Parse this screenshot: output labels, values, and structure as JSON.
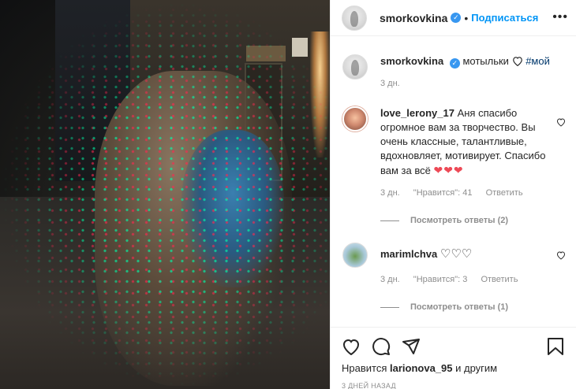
{
  "header": {
    "username": "smorkovkina",
    "separator": "•",
    "follow_label": "Подписаться",
    "more_label": "•••"
  },
  "caption": {
    "username": "smorkovkina",
    "text": "мотыльки",
    "hashtag": "#мой",
    "time": "3 дн."
  },
  "comments": [
    {
      "username": "love_lerony_17",
      "text": "Аня спасибо огромное вам за творчество. Вы очень классные, талантливые, вдохновляет, мотивирует. Спасибо вам за всё",
      "hearts": "❤❤❤",
      "time": "3 дн.",
      "likes": "\"Нравится\": 41",
      "reply": "Ответить",
      "view_replies": "Посмотреть ответы (2)"
    },
    {
      "username": "marimlchva",
      "text": "♡♡♡",
      "time": "3 дн.",
      "likes": "\"Нравится\": 3",
      "reply": "Ответить",
      "view_replies": "Посмотреть ответы (1)"
    }
  ],
  "footer": {
    "likes_prefix": "Нравится",
    "likes_user": "larionova_95",
    "likes_suffix": "и другим",
    "date": "3 ДНЕЙ НАЗАД"
  },
  "icons": [
    "heart-icon",
    "comment-icon",
    "share-icon",
    "bookmark-icon",
    "verified-icon",
    "more-icon"
  ],
  "colors": {
    "accent": "#0095f6",
    "verified": "#3897f0",
    "like_red": "#ed4956",
    "muted": "#8e8e8e"
  }
}
